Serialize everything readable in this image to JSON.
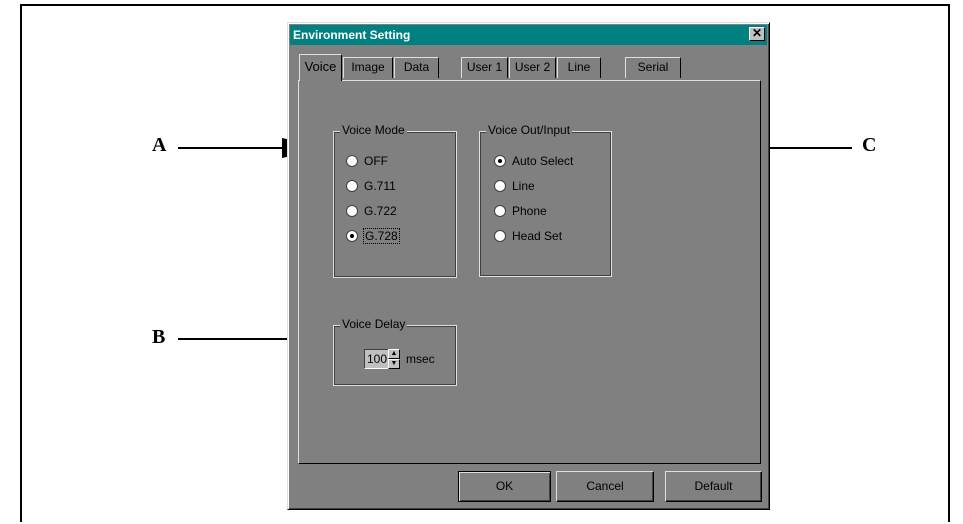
{
  "dialog": {
    "title": "Environment Setting",
    "close_glyph": "✕"
  },
  "tabs": [
    {
      "label": "Voice",
      "active": true
    },
    {
      "label": "Image"
    },
    {
      "label": "Data"
    },
    {
      "label": "User 1"
    },
    {
      "label": "User 2"
    },
    {
      "label": "Line"
    },
    {
      "label": "Serial"
    }
  ],
  "voice_mode": {
    "legend": "Voice Mode",
    "options": [
      "OFF",
      "G.711",
      "G.722",
      "G.728"
    ],
    "selected": "G.728"
  },
  "voice_out_input": {
    "legend": "Voice Out/Input",
    "options": [
      "Auto Select",
      "Line",
      "Phone",
      "Head Set"
    ],
    "selected": "Auto Select"
  },
  "voice_delay": {
    "legend": "Voice Delay",
    "value": "100",
    "unit": "msec",
    "up_glyph": "▲",
    "down_glyph": "▼"
  },
  "buttons": {
    "ok": "OK",
    "cancel": "Cancel",
    "default": "Default"
  },
  "callouts": {
    "a": "A",
    "b": "B",
    "c": "C"
  }
}
